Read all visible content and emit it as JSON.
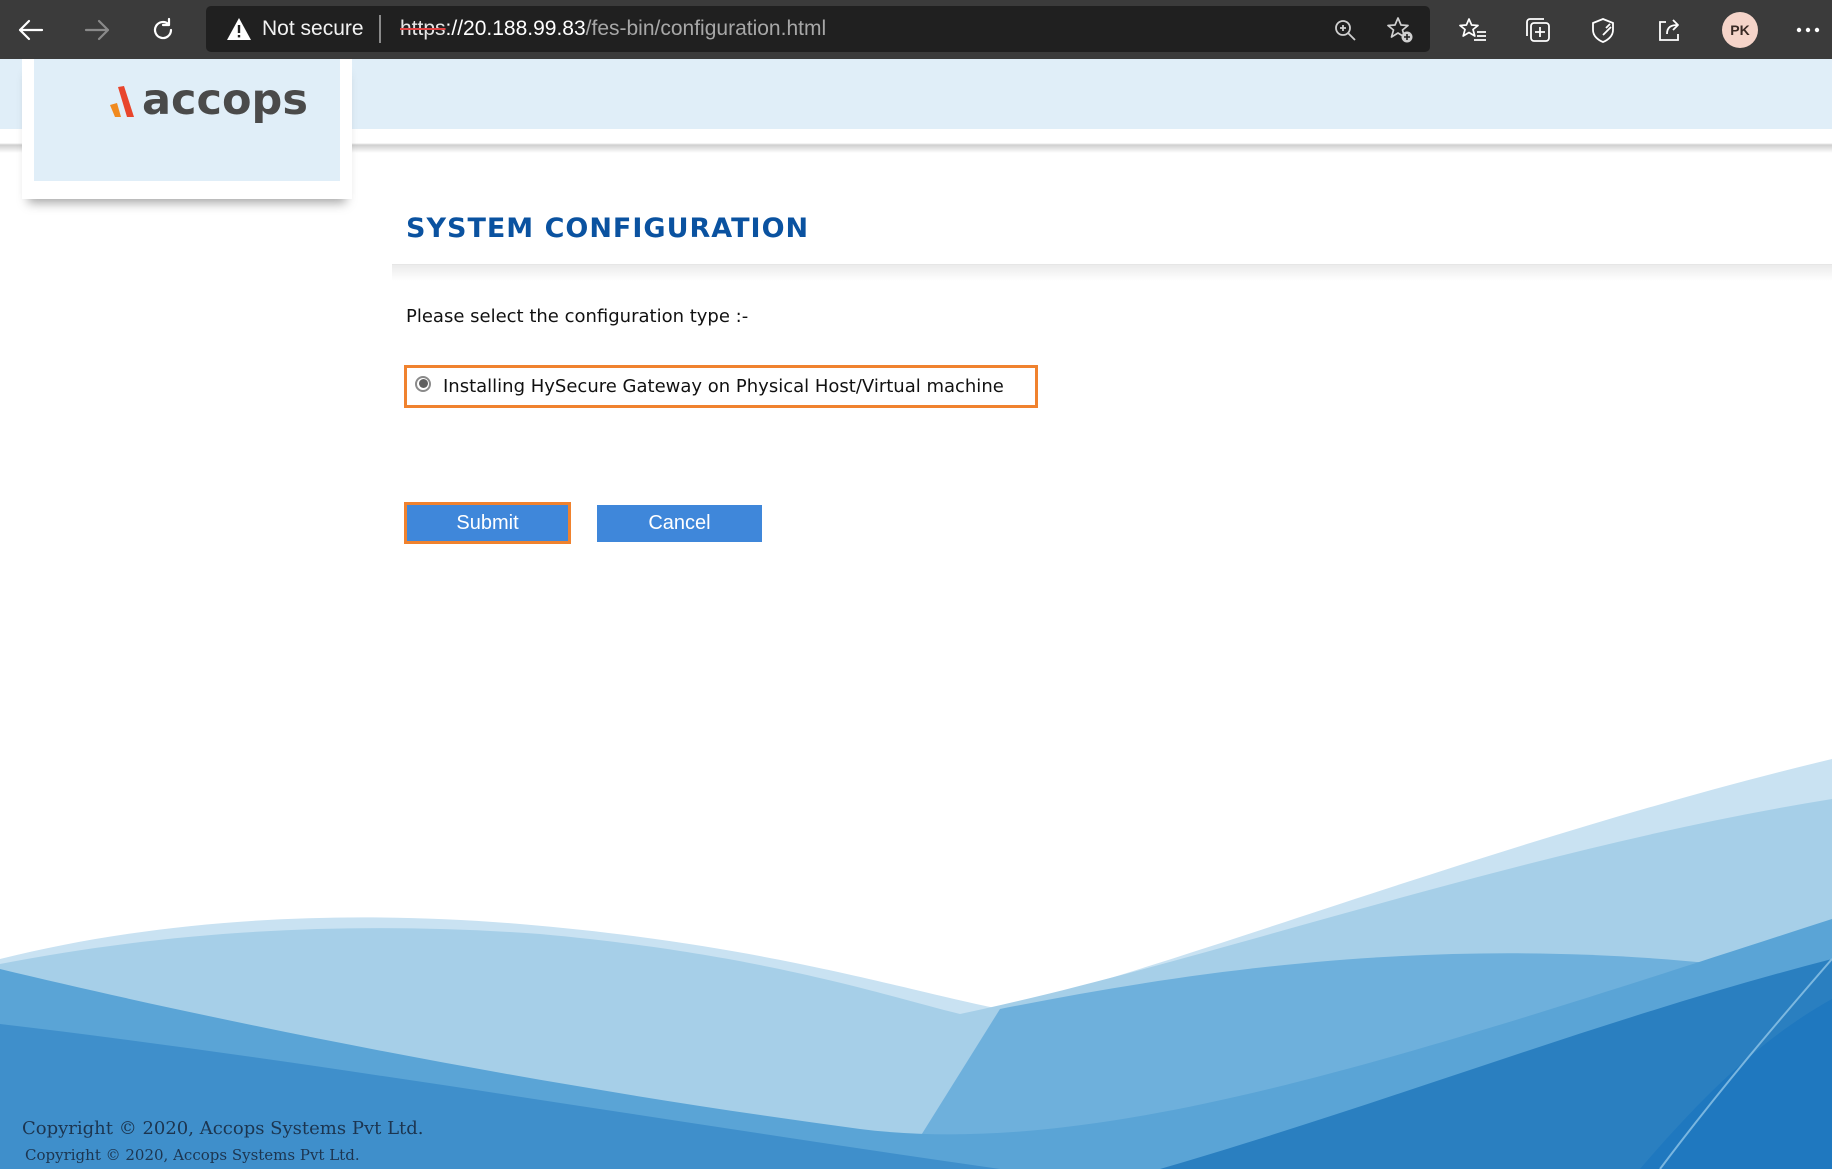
{
  "browser": {
    "security_label": "Not secure",
    "url_scheme": "https",
    "url_host": "://20.188.99.83",
    "url_path": "/fes-bin/configuration.html",
    "avatar_initials": "PK"
  },
  "logo": {
    "text": "accops"
  },
  "config": {
    "title": "SYSTEM CONFIGURATION",
    "prompt": "Please select the configuration type :-",
    "option_label": "Installing HySecure Gateway on Physical Host/Virtual machine",
    "option_selected": true
  },
  "buttons": {
    "submit": "Submit",
    "cancel": "Cancel"
  },
  "footer": {
    "copyright_1": "Copyright © 2020, Accops Systems Pvt Ltd.",
    "copyright_2": "Copyright © 2020, Accops Systems Pvt Ltd."
  },
  "colors": {
    "accent_orange": "#f0822e",
    "button_blue": "#3f87da",
    "title_blue": "#0a52a0",
    "wave_blue": "#2c86c7"
  }
}
